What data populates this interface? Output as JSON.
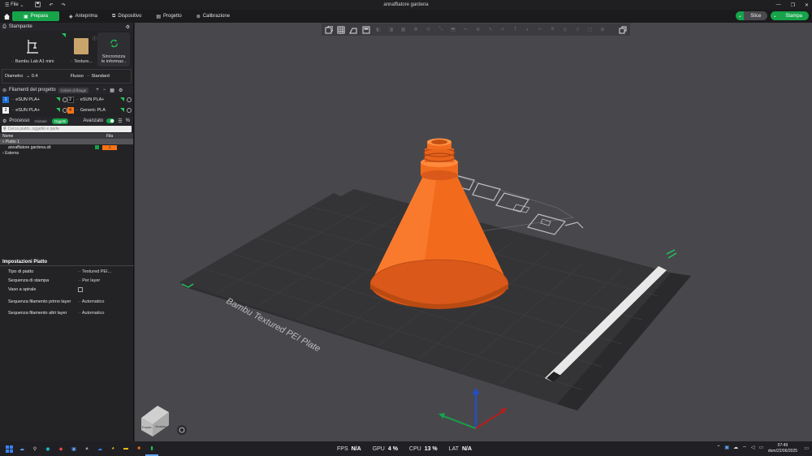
{
  "app": {
    "window_title": "annaffiatore gardena",
    "file_menu": "File"
  },
  "nav": {
    "tabs": [
      {
        "label": "Prepara"
      },
      {
        "label": "Anteprima"
      },
      {
        "label": "Dispositivo"
      },
      {
        "label": "Progetto"
      },
      {
        "label": "Calibrazione"
      }
    ],
    "slice_label": "Slice",
    "print_label": "Stampa"
  },
  "printer": {
    "section_title": "Stampante",
    "printer_name": "Bambu Lab A1 mini",
    "plate_name": "Texture...",
    "sync_label_1": "Sincronizza",
    "sync_label_2": "le informaz..",
    "diameter_label": "Diametro",
    "diameter_value": "0.4",
    "flow_label": "Flusso",
    "flow_value": "Standard"
  },
  "filaments": {
    "section_title": "Filamenti del progetto",
    "group_tag": "Colore di flauge",
    "items": [
      {
        "num": "1",
        "name": "eSUN PLA+",
        "color": "#1e6fd9"
      },
      {
        "num": "2",
        "name": "eSUN PLA+",
        "color": "#111111"
      },
      {
        "num": "3",
        "name": "eSUN PLA+",
        "color": "#f2f2f2"
      },
      {
        "num": "4",
        "name": "Generic PLA",
        "color": "#f97316"
      }
    ]
  },
  "process": {
    "section_title": "Processo",
    "global_tag": "Globale",
    "objects_badge": "Oggetti",
    "advanced_label": "Avanzato",
    "search_placeholder": "Cerca piatto, oggetto e parte",
    "col_name": "Nome",
    "col_filament": "Fila",
    "tree": [
      {
        "label": "Piatto 1",
        "selected": true
      },
      {
        "label": "annaffiatore gardena.stl",
        "filament": "4"
      },
      {
        "label": "Esterno"
      }
    ]
  },
  "plate_settings": {
    "title": "Impostazioni Piatto",
    "rows": [
      {
        "label": "Tipo di piatto",
        "value": "Textured PEI..."
      },
      {
        "label": "Sequenza di stampa",
        "value": "Per layer"
      },
      {
        "label": "Vaso a spirale",
        "value": ""
      },
      {
        "label": "Sequenza filamento primo layer",
        "value": "Automatico"
      },
      {
        "label": "Sequenza filamento altri layer",
        "value": "Automatico"
      }
    ]
  },
  "viewport": {
    "plate_text": "Bambu Textured PEI Plate",
    "cube_label_front": "Fronte",
    "cube_label_side": "Sinistra",
    "model_color": "#f26b1d"
  },
  "taskbar": {
    "fps_label": "FPS",
    "fps_value": "N/A",
    "gpu_label": "GPU",
    "gpu_value": "4 %",
    "cpu_label": "CPU",
    "cpu_value": "13 %",
    "lat_label": "LAT",
    "lat_value": "N/A",
    "time": "07:49",
    "date": "dom/22/06/2025"
  }
}
